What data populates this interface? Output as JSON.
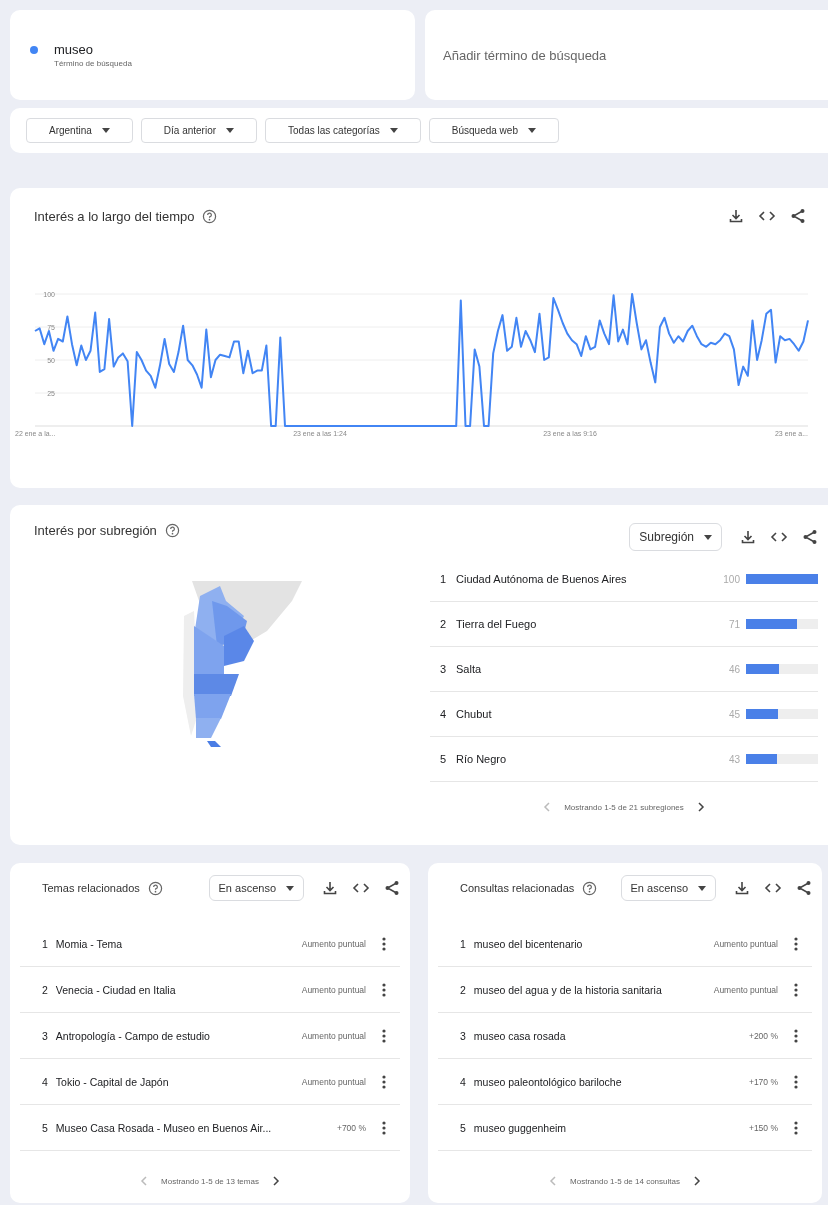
{
  "search_terms": [
    {
      "term": "museo",
      "subtitle": "Término de búsqueda",
      "color": "#4285f4"
    }
  ],
  "add_term": {
    "placeholder": "Añadir término de búsqueda"
  },
  "filters": [
    {
      "label": "Argentina"
    },
    {
      "label": "Día anterior"
    },
    {
      "label": "Todas las categorías"
    },
    {
      "label": "Búsqueda web"
    }
  ],
  "interest_over_time": {
    "title": "Interés a lo largo del tiempo",
    "x_axis_labels": [
      "22 ene a la...",
      "23 ene a las 1:24",
      "23 ene a las 9:16",
      "23 ene a..."
    ],
    "chart_data": {
      "type": "line",
      "grid": true,
      "ylim": [
        0,
        100
      ],
      "yticks": [
        25,
        50,
        75,
        100
      ],
      "series": [
        {
          "color": "#4285f4",
          "values": [
            72,
            74,
            62,
            72,
            57,
            66,
            64,
            83,
            62,
            46,
            61,
            50,
            57,
            86,
            41,
            43,
            81,
            45,
            52,
            55,
            49,
            0,
            56,
            50,
            42,
            38,
            29,
            46,
            66,
            47,
            41,
            56,
            76,
            50,
            46,
            39,
            29,
            73,
            37,
            50,
            54,
            53,
            52,
            64,
            64,
            40,
            57,
            40,
            42,
            42,
            61,
            0,
            0,
            67,
            0,
            0,
            0,
            0,
            0,
            0,
            0,
            0,
            0,
            0,
            0,
            0,
            0,
            0,
            0,
            0,
            0,
            0,
            0,
            0,
            0,
            0,
            0,
            0,
            0,
            0,
            0,
            0,
            0,
            0,
            0,
            0,
            0,
            0,
            0,
            0,
            0,
            0,
            95,
            0,
            0,
            58,
            45,
            0,
            0,
            55,
            72,
            84,
            57,
            60,
            82,
            60,
            72,
            65,
            56,
            85,
            50,
            52,
            97,
            88,
            78,
            70,
            65,
            62,
            53,
            68,
            58,
            60,
            80,
            70,
            62,
            99,
            64,
            73,
            62,
            100,
            78,
            58,
            65,
            48,
            33,
            75,
            82,
            70,
            63,
            68,
            64,
            72,
            76,
            68,
            62,
            60,
            63,
            62,
            65,
            70,
            68,
            58,
            31,
            45,
            38,
            80,
            50,
            65,
            85,
            88,
            48,
            68,
            65,
            66,
            62,
            57,
            64,
            80
          ]
        }
      ]
    }
  },
  "interest_by_subregion": {
    "title": "Interés por subregión",
    "dropdown": "Subregión",
    "regions": [
      {
        "rank": "1",
        "name": "Ciudad Autónoma de Buenos Aires",
        "value": "100",
        "level": 1
      },
      {
        "rank": "2",
        "name": "Tierra del Fuego",
        "value": "71",
        "level": 0.71
      },
      {
        "rank": "3",
        "name": "Salta",
        "value": "46",
        "level": 0.46
      },
      {
        "rank": "4",
        "name": "Chubut",
        "value": "45",
        "level": 0.45
      },
      {
        "rank": "5",
        "name": "Río Negro",
        "value": "43",
        "level": 0.43
      }
    ],
    "pagination": "Mostrando 1-5 de 21 subregiones"
  },
  "related_topics": {
    "title": "Temas relacionados",
    "dropdown": "En ascenso",
    "items": [
      {
        "rank": "1",
        "label": "Momia - Tema",
        "change": "Aumento puntual"
      },
      {
        "rank": "2",
        "label": "Venecia - Ciudad en Italia",
        "change": "Aumento puntual"
      },
      {
        "rank": "3",
        "label": "Antropología - Campo de estudio",
        "change": "Aumento puntual"
      },
      {
        "rank": "4",
        "label": "Tokio - Capital de Japón",
        "change": "Aumento puntual"
      },
      {
        "rank": "5",
        "label": "Museo Casa Rosada - Museo en Buenos Air...",
        "change": "+700 %"
      }
    ],
    "pagination": "Mostrando 1-5 de 13 temas"
  },
  "related_queries": {
    "title": "Consultas relacionadas",
    "dropdown": "En ascenso",
    "items": [
      {
        "rank": "1",
        "label": "museo del bicentenario",
        "change": "Aumento puntual"
      },
      {
        "rank": "2",
        "label": "museo del agua y de la historia sanitaria",
        "change": "Aumento puntual"
      },
      {
        "rank": "3",
        "label": "museo casa rosada",
        "change": "+200 %"
      },
      {
        "rank": "4",
        "label": "museo paleontológico bariloche",
        "change": "+170 %"
      },
      {
        "rank": "5",
        "label": "museo guggenheim",
        "change": "+150 %"
      }
    ],
    "pagination": "Mostrando 1-5 de 14 consultas"
  }
}
